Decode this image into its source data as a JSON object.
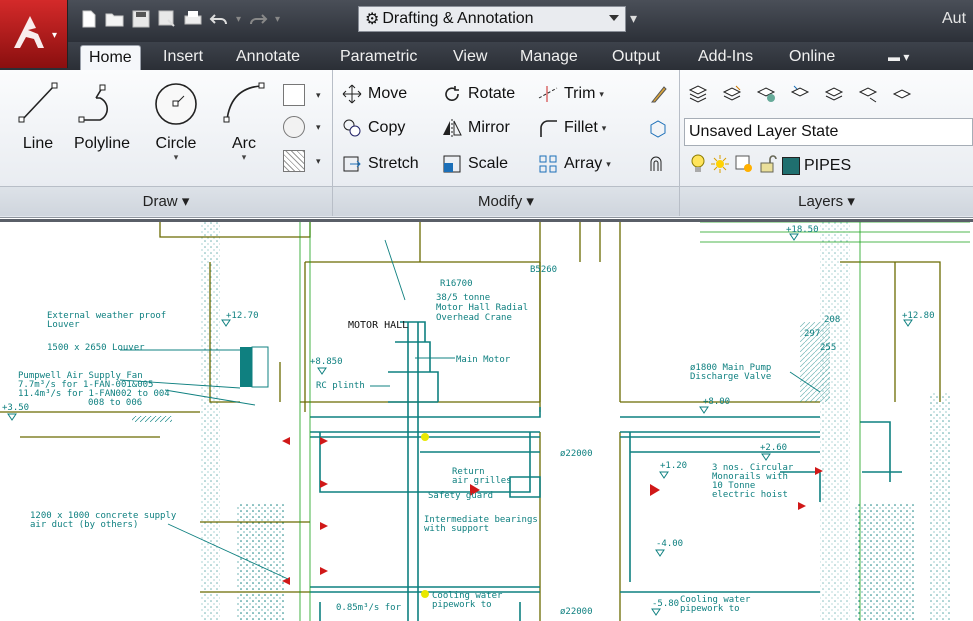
{
  "title_bar": {
    "workspace": "Drafting & Annotation",
    "app_title": "Aut"
  },
  "tabs": [
    "Home",
    "Insert",
    "Annotate",
    "Parametric",
    "View",
    "Manage",
    "Output",
    "Add-Ins",
    "Online"
  ],
  "active_tab": "Home",
  "ribbon": {
    "draw": {
      "title": "Draw",
      "line": "Line",
      "polyline": "Polyline",
      "circle": "Circle",
      "arc": "Arc"
    },
    "modify": {
      "title": "Modify",
      "move": "Move",
      "rotate": "Rotate",
      "trim": "Trim",
      "copy": "Copy",
      "mirror": "Mirror",
      "fillet": "Fillet",
      "stretch": "Stretch",
      "scale": "Scale",
      "array": "Array"
    },
    "layers": {
      "title": "Layers",
      "layer_state": "Unsaved Layer State",
      "current_layer": "PIPES"
    }
  },
  "colors": {
    "app_button": "#c81e1e",
    "layer_swatch": "#1f6f6f",
    "drawing_teal": "#0f8080",
    "drawing_olive": "#6b6b00",
    "drawing_red": "#d01818",
    "drawing_green": "#16a016"
  },
  "drawing": {
    "labels": {
      "r16700": "R16700",
      "b5260": "B5260",
      "crane": "38/5 tonne\nMotor Hall Radial\nOverhead Crane",
      "motor_hall": "MOTOR HALL",
      "main_motor": "Main Motor",
      "external_louver": "External weather proof\nLouver",
      "louver_size": "1500 x 2650 Louver",
      "pumpwell_fan": "Pumpwell Air Supply Fan\n7.7m³/s for 1-FAN-001&005\n11.4m³/s for 1-FAN002 to 004\n008 to 006",
      "rc_plinth": "RC plinth",
      "elev_1270_left": "+12.70",
      "elev_1270_right": "+12.80",
      "elev_885": "+8.850",
      "elev_350": "+3.50",
      "elev_1850": "+18.50",
      "elev_800": "+8.00",
      "elev_260": "+2.60",
      "elev_120": "+1.20",
      "elev_400": "-4.00",
      "elev_580": "-5.80",
      "pump_valve": "ø1800 Main Pump\nDischarge Valve",
      "dim_22000_a": "ø22000",
      "dim_22000_b": "ø22000",
      "return_grilles": "Return\nair grilles",
      "safety_guard": "Safety guard",
      "intermediate_bearings": "Intermediate bearings\nwith support",
      "monorails": "3 nos. Circular\nMonorails with\n10 Tonne\nelectric hoist",
      "concrete_duct": "1200 x 1000 concrete supply\nair duct (by others)",
      "cooling_water_a": "Cooling water\npipework to",
      "cooling_water_b": "Cooling water\npipework to",
      "flow_085": "0.85m³/s for",
      "dim_297": "297",
      "dim_208": "208",
      "dim_255": "255"
    }
  }
}
